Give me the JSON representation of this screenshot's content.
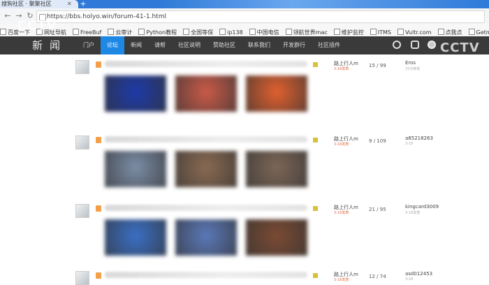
{
  "browser": {
    "tab_title": "搜狗社区 · 聚聚社区",
    "url": "https://bbs.holyo.win/forum-41-1.html",
    "bookmarks": [
      "百度一下",
      "网址导航",
      "FreeBuf",
      "云审计",
      "Python教程",
      "全国等保",
      "ip138",
      "中国电信",
      "领航世界mac",
      "维护监控",
      "ITMS",
      "Vultr.com",
      "点我点",
      "Getman"
    ]
  },
  "site": {
    "logo": "新闻",
    "nav": [
      "门户",
      "论坛",
      "新闻",
      "请帮",
      "社区说明",
      "赞助社区",
      "联系我们",
      "开发群行",
      "社区插件"
    ],
    "active_nav": 1
  },
  "watermark": {
    "text": "CCTV"
  },
  "threads": [
    {
      "author": "路上行人m",
      "author_sub": "3-18发表",
      "replies": "15",
      "views": "99",
      "last_user": "Eros",
      "last_time": "15分钟前",
      "thumb_colors": [
        "#1d3aa8",
        "#c95a48",
        "#e0602e"
      ]
    },
    {
      "author": "路上行人m",
      "author_sub": "3-18发表",
      "replies": "9",
      "views": "109",
      "last_user": "a85218263",
      "last_time": "3-18",
      "thumb_colors": [
        "#7b8da6",
        "#8a6a52",
        "#7c6656"
      ]
    },
    {
      "author": "路上行人m",
      "author_sub": "3-18发表",
      "replies": "21",
      "views": "95",
      "last_user": "kingcard3009",
      "last_time": "3-18发表",
      "thumb_colors": [
        "#3a6fc4",
        "#5a78b8",
        "#7a4a33"
      ]
    },
    {
      "author": "路上行人m",
      "author_sub": "3-18发表",
      "replies": "12",
      "views": "74",
      "last_user": "asd012453",
      "last_time": "3-18",
      "thumb_colors": [
        "#cccccc",
        "#cccccc",
        "#cccccc"
      ]
    }
  ]
}
